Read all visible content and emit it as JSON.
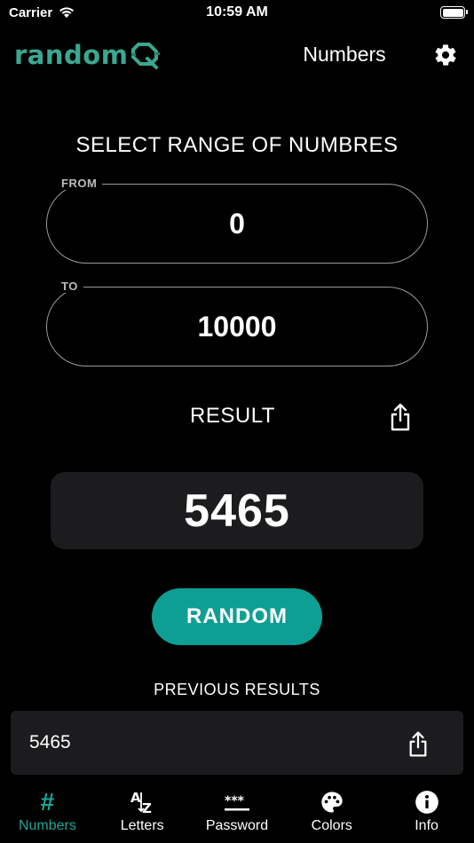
{
  "status_bar": {
    "carrier": "Carrier",
    "time": "10:59 AM"
  },
  "header": {
    "logo_text": "random",
    "title": "Numbers"
  },
  "range": {
    "title": "SELECT RANGE OF NUMBRES",
    "from_label": "FROM",
    "from_value": "0",
    "to_label": "TO",
    "to_value": "10000"
  },
  "result": {
    "label": "RESULT",
    "value": "5465"
  },
  "random_button": "RANDOM",
  "previous": {
    "title": "PREVIOUS RESULTS",
    "items": [
      "5465"
    ]
  },
  "tabs": [
    {
      "label": "Numbers",
      "icon": "hash-icon",
      "active": true
    },
    {
      "label": "Letters",
      "icon": "az-sort-icon",
      "active": false
    },
    {
      "label": "Password",
      "icon": "password-icon",
      "active": false
    },
    {
      "label": "Colors",
      "icon": "palette-icon",
      "active": false
    },
    {
      "label": "Info",
      "icon": "info-icon",
      "active": false
    }
  ],
  "colors": {
    "accent": "#0e9f94",
    "background": "#000000",
    "surface": "#1c1c1e"
  }
}
